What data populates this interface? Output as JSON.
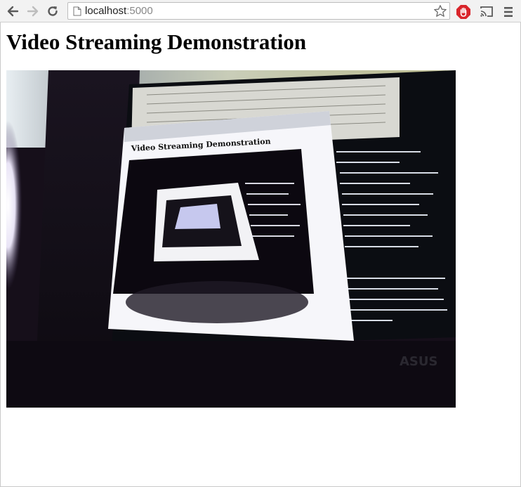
{
  "browser": {
    "url_host": "localhost",
    "url_port": ":5000",
    "icons": {
      "back": "arrow-left-icon",
      "forward": "arrow-right-icon",
      "reload": "reload-icon",
      "page": "page-icon",
      "bookmark": "star-icon",
      "extension": "stop-hand-icon",
      "cast": "cast-icon",
      "menu": "hamburger-menu-icon"
    },
    "colors": {
      "toolbar": "#f2f2f2",
      "extension_red": "#d9252b"
    }
  },
  "page": {
    "heading": "Video Streaming Demonstration"
  },
  "video": {
    "inner_heading": "Video Streaming Demonstration"
  }
}
